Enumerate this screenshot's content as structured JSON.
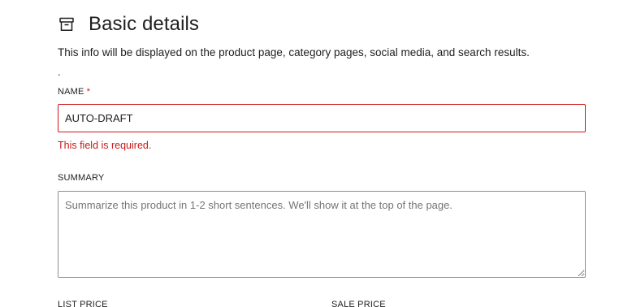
{
  "section": {
    "icon": "archive-icon",
    "title": "Basic details",
    "description": "This info will be displayed on the product page, category pages, social media, and search results.",
    "stray_dot": "."
  },
  "fields": {
    "name": {
      "label": "NAME",
      "required_mark": "*",
      "value": "AUTO-DRAFT",
      "error": "This field is required."
    },
    "summary": {
      "label": "SUMMARY",
      "placeholder": "Summarize this product in 1-2 short sentences. We'll show it at the top of the page.",
      "value": ""
    },
    "list_price": {
      "label": "LIST PRICE"
    },
    "sale_price": {
      "label": "SALE PRICE"
    }
  },
  "colors": {
    "error": "#cc1818",
    "text": "#1e1e1e",
    "placeholder": "#757575",
    "border": "#8c8f94"
  }
}
